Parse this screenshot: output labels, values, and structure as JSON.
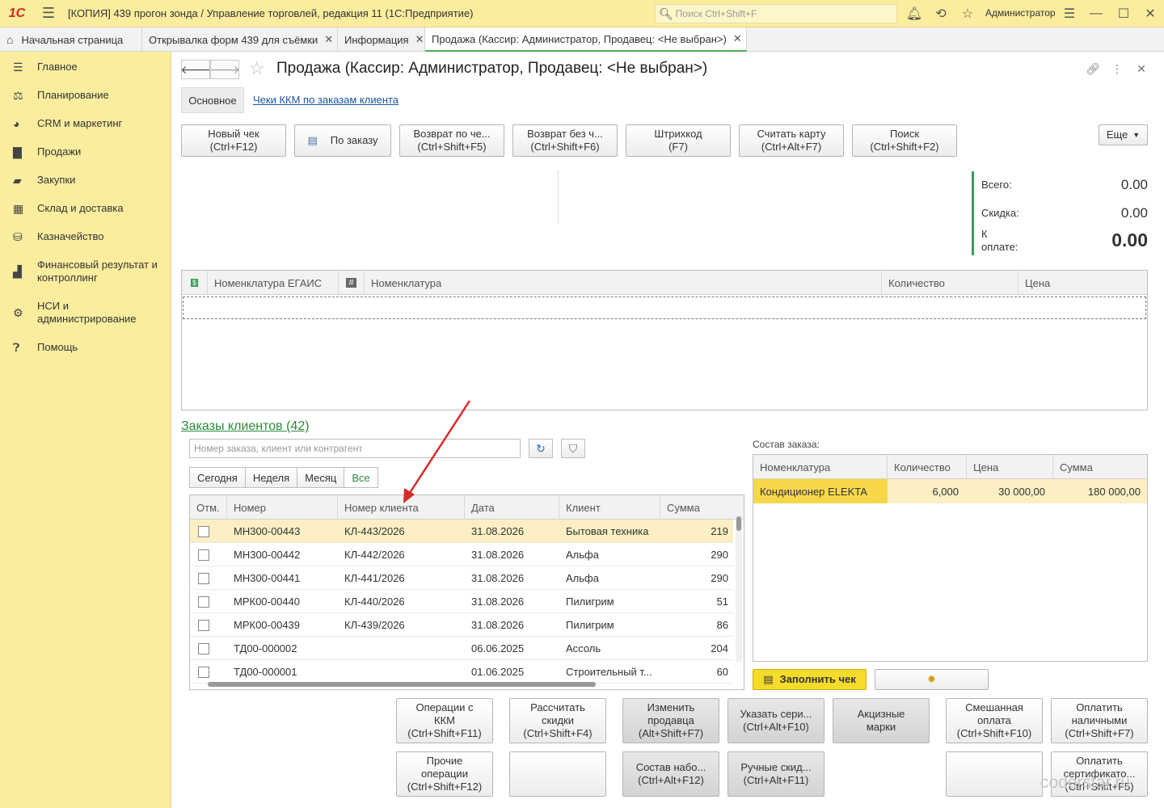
{
  "window": {
    "logo": "1С",
    "title": "[КОПИЯ] 439 прогон зонда / Управление торговлей, редакция 11  (1С:Предприятие)",
    "search_placeholder": "Поиск Ctrl+Shift+F",
    "user": "Администратор"
  },
  "tabs": [
    {
      "label": "Начальная страница"
    },
    {
      "label": "Открывалка форм 439 для съёмки"
    },
    {
      "label": "Информация"
    },
    {
      "label": "Продажа (Кассир: Администратор, Продавец: <Не выбран>)"
    }
  ],
  "sidebar": {
    "items": [
      {
        "label": "Главное",
        "icon": "list-icon"
      },
      {
        "label": "Планирование",
        "icon": "planning-icon"
      },
      {
        "label": "CRM и маркетинг",
        "icon": "crm-icon"
      },
      {
        "label": "Продажи",
        "icon": "bag-icon"
      },
      {
        "label": "Закупки",
        "icon": "cart-icon"
      },
      {
        "label": "Склад и доставка",
        "icon": "warehouse-icon"
      },
      {
        "label": "Казначейство",
        "icon": "coins-icon"
      },
      {
        "label": "Финансовый результат и контроллинг",
        "icon": "chart-icon"
      },
      {
        "label": "НСИ и администрирование",
        "icon": "gear-icon"
      },
      {
        "label": "Помощь",
        "icon": "help-icon"
      }
    ]
  },
  "page": {
    "title": "Продажа (Кассир: Администратор, Продавец: <Не выбран>)",
    "subtab_main": "Основное",
    "subtab_link": "Чеки ККМ по заказам клиента"
  },
  "toolbar": {
    "new_check": [
      "Новый чек",
      "(Ctrl+F12)"
    ],
    "by_order": "По заказу",
    "return_check": [
      "Возврат по че...",
      "(Ctrl+Shift+F5)"
    ],
    "return_no_check": [
      "Возврат без ч...",
      "(Ctrl+Shift+F6)"
    ],
    "barcode": [
      "Штрихкод",
      "(F7)"
    ],
    "read_card": [
      "Считать карту",
      "(Ctrl+Alt+F7)"
    ],
    "search": [
      "Поиск",
      "(Ctrl+Shift+F2)"
    ],
    "more": "Еще"
  },
  "totals": {
    "total_label": "Всего:",
    "total_value": "0.00",
    "discount_label": "Скидка:",
    "discount_value": "0.00",
    "to_pay_label": [
      "К",
      "оплате:"
    ],
    "to_pay_value": "0.00",
    "accent": "#3a9d5a"
  },
  "items_table": {
    "columns": [
      "Номенклатура ЕГАИС",
      "Номенклатура",
      "Количество",
      "Цена"
    ]
  },
  "orders": {
    "title": "Заказы клиентов (42)",
    "search_placeholder": "Номер заказа, клиент или контрагент",
    "periods": [
      "Сегодня",
      "Неделя",
      "Месяц",
      "Все"
    ],
    "columns": [
      "Отм.",
      "Номер",
      "Номер клиента",
      "Дата",
      "Клиент",
      "Сумма"
    ],
    "rows": [
      {
        "number": "МН300-00443",
        "client_number": "КЛ-443/2026",
        "date": "31.08.2026",
        "client": "Бытовая техника",
        "sum": "219"
      },
      {
        "number": "МН300-00442",
        "client_number": "КЛ-442/2026",
        "date": "31.08.2026",
        "client": "Альфа",
        "sum": "290"
      },
      {
        "number": "МН300-00441",
        "client_number": "КЛ-441/2026",
        "date": "31.08.2026",
        "client": "Альфа",
        "sum": "290"
      },
      {
        "number": "МРК00-00440",
        "client_number": "КЛ-440/2026",
        "date": "31.08.2026",
        "client": "Пилигрим",
        "sum": "51"
      },
      {
        "number": "МРК00-00439",
        "client_number": "КЛ-439/2026",
        "date": "31.08.2026",
        "client": "Пилигрим",
        "sum": "86"
      },
      {
        "number": "ТД00-000002",
        "client_number": "",
        "date": "06.06.2025",
        "client": "Ассоль",
        "sum": "204"
      },
      {
        "number": "ТД00-000001",
        "client_number": "",
        "date": "01.06.2025",
        "client": "Строительный т...",
        "sum": "60"
      }
    ]
  },
  "composition": {
    "label": "Состав заказа:",
    "columns": [
      "Номенклатура",
      "Количество",
      "Цена",
      "Сумма"
    ],
    "rows": [
      {
        "item": "Кондиционер ELEKTA",
        "qty": "6,000",
        "price": "30 000,00",
        "sum": "180 000,00"
      }
    ]
  },
  "bottom_buttons": {
    "fill_check": "Заполнить чек",
    "kkm_ops": [
      "Операции с",
      "ККМ",
      "(Ctrl+Shift+F11)"
    ],
    "calc_discounts": [
      "Рассчитать",
      "скидки",
      "(Ctrl+Shift+F4)"
    ],
    "change_seller": [
      "Изменить",
      "продавца",
      "(Alt+Shift+F7)"
    ],
    "set_serial": [
      "Указать сери...",
      "(Ctrl+Alt+F10)"
    ],
    "excise": [
      "Акцизные",
      "марки"
    ],
    "mixed_pay": [
      "Смешанная",
      "оплата",
      "(Ctrl+Shift+F10)"
    ],
    "pay_cash": [
      "Оплатить",
      "наличными",
      "(Ctrl+Shift+F7)"
    ],
    "other_ops": [
      "Прочие",
      "операции",
      "(Ctrl+Shift+F12)"
    ],
    "kit_composition": [
      "Состав набо...",
      "(Ctrl+Alt+F12)"
    ],
    "manual_discount": [
      "Ручные скид...",
      "(Ctrl+Alt+F11)"
    ],
    "pay_certificate": [
      "Оплатить",
      "сертификато...",
      "(Ctrl+Shift+F5)"
    ]
  },
  "watermark": "coderstar.ru",
  "colors": {
    "sidebar_bg": "#fbed9e",
    "selected_row": "#fbefc3",
    "link": "#1a56a6",
    "green": "#2a8a3c",
    "arrow": "#d62a2a"
  }
}
